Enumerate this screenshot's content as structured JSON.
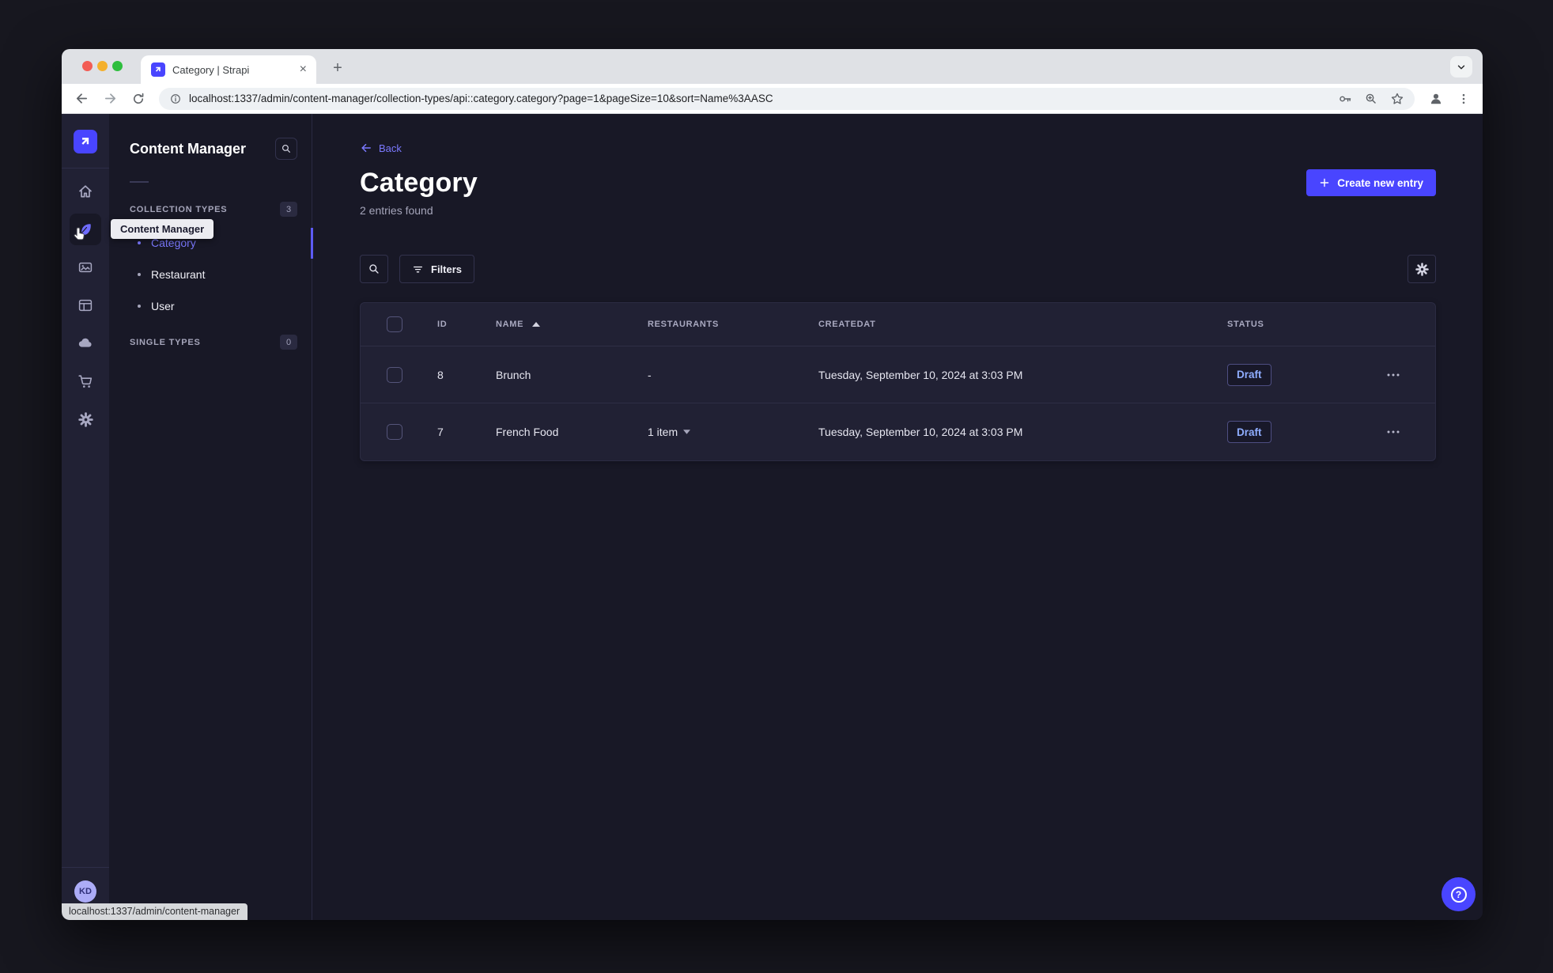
{
  "browser": {
    "tab_title": "Category | Strapi",
    "url": "localhost:1337/admin/content-manager/collection-types/api::category.category?page=1&pageSize=10&sort=Name%3AASC",
    "status_link": "localhost:1337/admin/content-manager",
    "new_tab_label": "+",
    "close_tab_label": "×"
  },
  "rail": {
    "tooltip": "Content Manager",
    "avatar_initials": "KD",
    "icons": [
      "strapi-logo",
      "home",
      "content-manager",
      "media-library",
      "content-type-builder",
      "cloud",
      "marketplace",
      "settings"
    ]
  },
  "nav": {
    "title": "Content Manager",
    "collection_types": {
      "label": "COLLECTION TYPES",
      "count": "3",
      "items": [
        {
          "label": "Category",
          "active": true
        },
        {
          "label": "Restaurant",
          "active": false
        },
        {
          "label": "User",
          "active": false
        }
      ]
    },
    "single_types": {
      "label": "SINGLE TYPES",
      "count": "0"
    }
  },
  "main": {
    "back_label": "Back",
    "title": "Category",
    "subtitle": "2 entries found",
    "create_button_label": "Create new entry",
    "filters_button_label": "Filters",
    "help_label": "?",
    "table": {
      "headers": {
        "id": "ID",
        "name": "NAME",
        "restaurants": "RESTAURANTS",
        "created_at": "CREATEDAT",
        "status": "STATUS"
      },
      "rows": [
        {
          "id": "8",
          "name": "Brunch",
          "restaurants": "-",
          "created_at": "Tuesday, September 10, 2024 at 3:03 PM",
          "status": "Draft"
        },
        {
          "id": "7",
          "name": "French Food",
          "restaurants": "1 item",
          "created_at": "Tuesday, September 10, 2024 at 3:03 PM",
          "status": "Draft"
        }
      ]
    }
  },
  "colors": {
    "accent": "#4945ff",
    "link": "#7b79ff",
    "draft_text": "#8fadff",
    "app_background": "#181826",
    "card_background": "#212134"
  }
}
